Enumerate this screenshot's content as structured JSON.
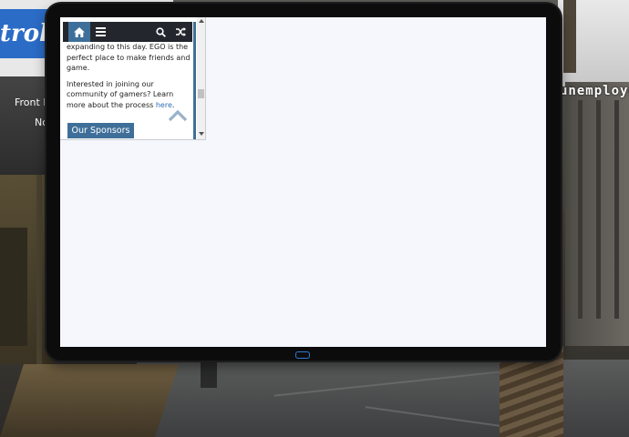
{
  "background": {
    "billboard_text": "trols",
    "billboard_line1": "Front L",
    "billboard_line2": "No",
    "building_sign": "unemploye"
  },
  "browser": {
    "nav": {
      "home_icon": "home-icon",
      "menu_icon": "hamburger-menu-icon",
      "search_icon": "search-icon",
      "random_icon": "shuffle-icon"
    },
    "content": {
      "para1": "expanding to this day. EGO is the perfect place to make friends and game.",
      "para2_text": "Interested in joining our community of gamers? Learn more about the process ",
      "para2_link": "here",
      "para2_end": "."
    },
    "sponsors_label": "Our Sponsors"
  },
  "colors": {
    "accent": "#3f6f99",
    "navbar": "#23272d",
    "screen": "#f6f7fc",
    "link": "#2e6fb5"
  }
}
